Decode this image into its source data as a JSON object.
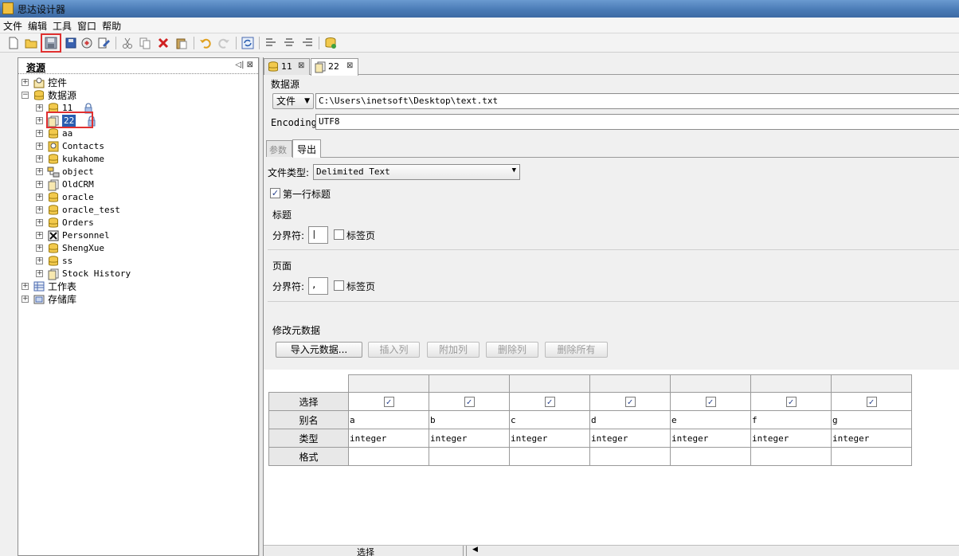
{
  "window": {
    "title": "思达设计器"
  },
  "menu": [
    "文件",
    "编辑",
    "工具",
    "窗口",
    "帮助"
  ],
  "left_panel": {
    "title": "资源",
    "buttons": "◁| ⊠",
    "tree": [
      {
        "label": "控件",
        "icon": "component-icon",
        "level": 0
      },
      {
        "label": "数据源",
        "icon": "datasource-icon",
        "level": 0,
        "expanded": true
      },
      {
        "label": "11",
        "icon": "database-icon",
        "level": 1,
        "locked": true
      },
      {
        "label": "22",
        "icon": "file-icon",
        "level": 1,
        "locked": true,
        "selected": true
      },
      {
        "label": "aa",
        "icon": "database-icon",
        "level": 1
      },
      {
        "label": "Contacts",
        "icon": "contacts-icon",
        "level": 1
      },
      {
        "label": "kukahome",
        "icon": "database-icon",
        "level": 1
      },
      {
        "label": "object",
        "icon": "object-icon",
        "level": 1
      },
      {
        "label": "OldCRM",
        "icon": "file-icon",
        "level": 1
      },
      {
        "label": "oracle",
        "icon": "database-icon",
        "level": 1
      },
      {
        "label": "oracle_test",
        "icon": "database-icon",
        "level": 1
      },
      {
        "label": "Orders",
        "icon": "database-icon",
        "level": 1
      },
      {
        "label": "Personnel",
        "icon": "excel-icon",
        "level": 1
      },
      {
        "label": "ShengXue",
        "icon": "database-icon",
        "level": 1
      },
      {
        "label": "ss",
        "icon": "database-icon",
        "level": 1
      },
      {
        "label": "Stock History",
        "icon": "file-icon",
        "level": 1
      },
      {
        "label": "工作表",
        "icon": "worksheet-icon",
        "level": 0
      },
      {
        "label": "存储库",
        "icon": "repository-icon",
        "level": 0
      }
    ]
  },
  "tabs": [
    {
      "label": "11",
      "close": "⊠"
    },
    {
      "label": "22",
      "close": "⊠"
    }
  ],
  "datasource": {
    "heading": "数据源",
    "type_select": "文件",
    "path": "C:\\Users\\inetsoft\\Desktop\\text.txt",
    "encoding_label": "Encoding:",
    "encoding": "UTF8"
  },
  "subtabs": [
    "参数",
    "导出"
  ],
  "export": {
    "file_type_label": "文件类型:",
    "file_type": "Delimited Text",
    "first_row_header_label": "第一行标题",
    "header_section": "标题",
    "header_delim_label": "分界符:",
    "header_delim": "|",
    "header_tab_label": "标签页",
    "body_section": "页面",
    "body_delim_label": "分界符:",
    "body_delim": ",",
    "body_tab_label": "标签页",
    "meta_section": "修改元数据",
    "buttons": {
      "import": "导入元数据...",
      "insert": "插入列",
      "append": "附加列",
      "delete": "删除列",
      "delete_all": "删除所有"
    }
  },
  "meta_table": {
    "row_headers": [
      "选择",
      "别名",
      "类型",
      "格式"
    ],
    "aliases": [
      "a",
      "b",
      "c",
      "d",
      "e",
      "f",
      "g"
    ],
    "types": [
      "integer",
      "integer",
      "integer",
      "integer",
      "integer",
      "integer",
      "integer"
    ],
    "formats": [
      "",
      "",
      "",
      "",
      "",
      "",
      ""
    ],
    "selected": [
      true,
      true,
      true,
      true,
      true,
      true,
      true
    ]
  },
  "bottom": {
    "label": "选择"
  }
}
